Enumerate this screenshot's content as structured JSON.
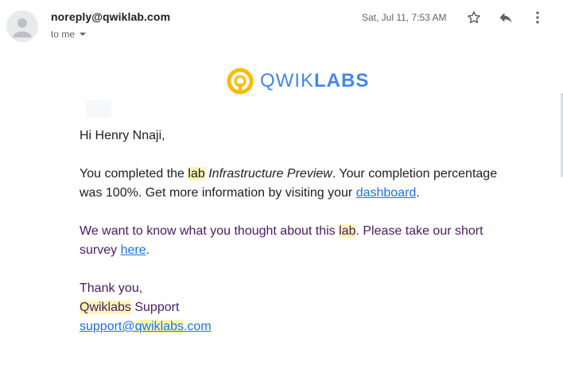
{
  "header": {
    "sender_email": "noreply@qwiklab.com",
    "recipient_label": "to me",
    "timestamp": "Sat, Jul 11, 7:53 AM",
    "icons": {
      "avatar": "person-avatar-icon",
      "star": "star-icon",
      "reply": "reply-icon",
      "more": "more-vertical-icon",
      "caret": "caret-down-icon"
    }
  },
  "email": {
    "logo": {
      "icon": "qwiklabs-logo-icon",
      "word_light": "QWIK",
      "word_bold": "LABS",
      "colors": {
        "ring": "#fbbc04",
        "text": "#4285f4"
      }
    },
    "greeting": "Hi Henry Nnaji,",
    "p1": {
      "t1": "You completed the ",
      "hl": "lab",
      "sp": " ",
      "lab_name": "Infrastructure Preview",
      "t2": ". Your completion percentage",
      "t3": "was 100%. Get more information by visiting your ",
      "link": "dashboard",
      "end": "."
    },
    "p2": {
      "t1": "We want to know what you thought about this ",
      "hl": "lab",
      "t2": ". Please take our short",
      "t3": "survey ",
      "link": "here",
      "end": "."
    },
    "closing": {
      "thanks": "Thank you,",
      "company_hl": "Qwiklabs",
      "company_rest": " Support",
      "email_a": "support@",
      "email_hl": "qwiklabs",
      "email_b": ".com"
    }
  },
  "colors": {
    "link": "#1a73e8",
    "highlight": "#fdf6b6",
    "body_text": "#202124",
    "purple_text": "#4a1b63",
    "muted": "#5f6368"
  }
}
